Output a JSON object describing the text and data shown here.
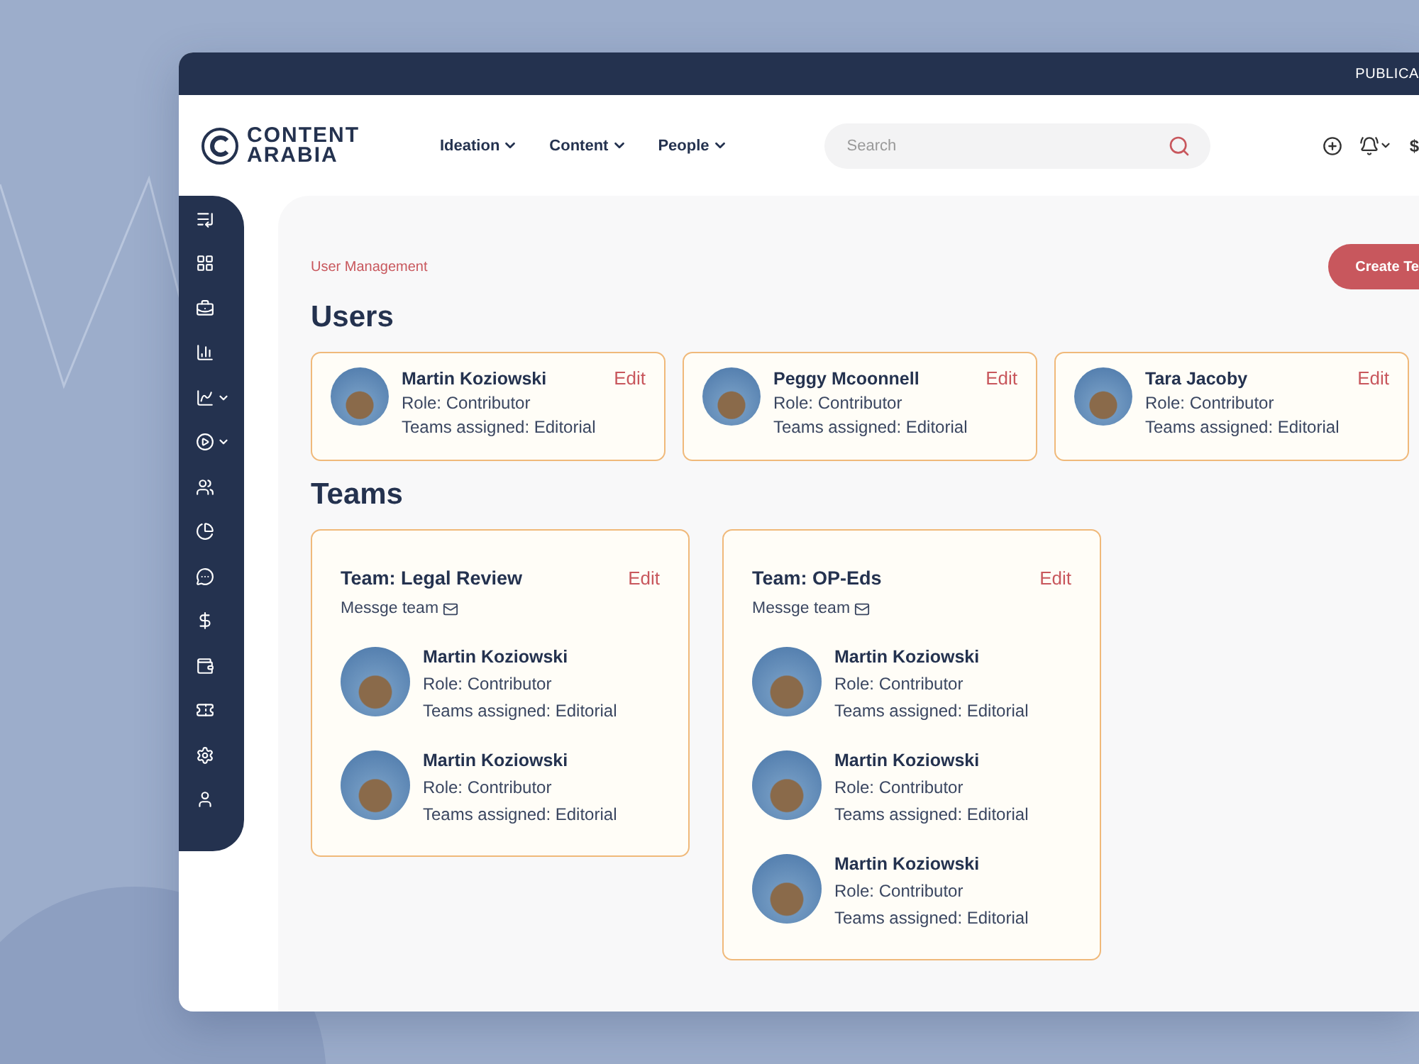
{
  "top_bar": {
    "label": "PUBLICA"
  },
  "header": {
    "logo": {
      "line_1": "CONTENT",
      "line_2": "ARABIA"
    },
    "nav": [
      {
        "label": "Ideation"
      },
      {
        "label": "Content"
      },
      {
        "label": "People"
      }
    ],
    "search": {
      "placeholder": "Search"
    },
    "currency": "$"
  },
  "sidebar": {
    "items": [
      {
        "expandable": false
      },
      {
        "expandable": false
      },
      {
        "expandable": false
      },
      {
        "expandable": false
      },
      {
        "expandable": true
      },
      {
        "expandable": true
      },
      {
        "expandable": false
      },
      {
        "expandable": false
      },
      {
        "expandable": false
      },
      {
        "expandable": false
      },
      {
        "expandable": false
      },
      {
        "expandable": false
      },
      {
        "expandable": false
      },
      {
        "expandable": false
      }
    ]
  },
  "breadcrumb": "User Management",
  "create_button": "Create Te",
  "users": {
    "title": "Users",
    "items": [
      {
        "name": "Martin Koziowski",
        "role": "Role: Contributor",
        "teams": "Teams assigned: Editorial",
        "edit": "Edit"
      },
      {
        "name": "Peggy Mcoonnell",
        "role": "Role: Contributor",
        "teams": "Teams assigned: Editorial",
        "edit": "Edit"
      },
      {
        "name": "Tara Jacoby",
        "role": "Role: Contributor",
        "teams": "Teams assigned: Editorial",
        "edit": "Edit"
      }
    ]
  },
  "teams": {
    "title": "Teams",
    "items": [
      {
        "title": "Team: Legal Review",
        "edit": "Edit",
        "message": "Messge team",
        "members": [
          {
            "name": "Martin Koziowski",
            "role": "Role: Contributor",
            "teams": "Teams assigned: Editorial"
          },
          {
            "name": "Martin Koziowski",
            "role": "Role: Contributor",
            "teams": "Teams assigned: Editorial"
          }
        ]
      },
      {
        "title": "Team: OP-Eds",
        "edit": "Edit",
        "message": "Messge team",
        "members": [
          {
            "name": "Martin Koziowski",
            "role": "Role: Contributor",
            "teams": "Teams assigned: Editorial"
          },
          {
            "name": "Martin Koziowski",
            "role": "Role: Contributor",
            "teams": "Teams assigned: Editorial"
          },
          {
            "name": "Martin Koziowski",
            "role": "Role: Contributor",
            "teams": "Teams assigned: Editorial"
          }
        ]
      }
    ]
  }
}
